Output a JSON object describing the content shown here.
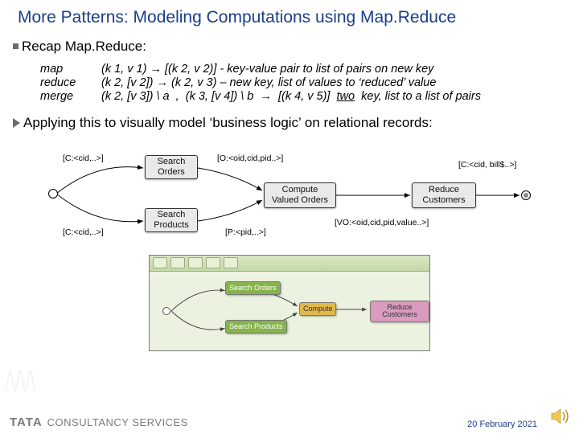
{
  "title": "More Patterns: Modeling Computations using Map.Reduce",
  "section1": {
    "heading": "Recap Map.Reduce:",
    "defs": [
      {
        "name": "map",
        "body": "(k 1, v 1)  →   [(k 2, v 2)]   - key-value pair to list of pairs on new key"
      },
      {
        "name": "reduce",
        "body": "(k 2, [v 2])  →   (k 2, v 3) – new key, list of values to ‘reduced’ value"
      },
      {
        "name": "merge",
        "body": "(k 2, [v 3]) \\ a  ,  (k 3, [v 4]) \\ b  →   [(k 4, v 5)]   two  key, list to a list of pairs"
      }
    ]
  },
  "section2": {
    "heading": "Applying this to visually model ‘business logic’ on relational records:"
  },
  "diagram1": {
    "boxes": {
      "searchOrders": "Search\nOrders",
      "searchProducts": "Search\nProducts",
      "compute": "Compute\nValued Orders",
      "reduceCust": "Reduce\nCustomers"
    },
    "labels": {
      "l1": "[C:<cid,..>]",
      "l2": "[C:<cid,..>]",
      "l3": "[O:<oid,cid,pid..>]",
      "l4": "[P:<pid,..>]",
      "l5": "[VO:<oid,cid,pid,value..>]",
      "l6": "[C:<cid, bill$..>]"
    }
  },
  "diagram2": {
    "boxes": {
      "a": "Search\nOrders",
      "b": "Search\nProducts",
      "c": "Compute",
      "d": "Reduce\nCustomers"
    }
  },
  "footer": {
    "logo1": "TATA",
    "logo2": "CONSULTANCY SERVICES",
    "date": "20 February 2021"
  }
}
